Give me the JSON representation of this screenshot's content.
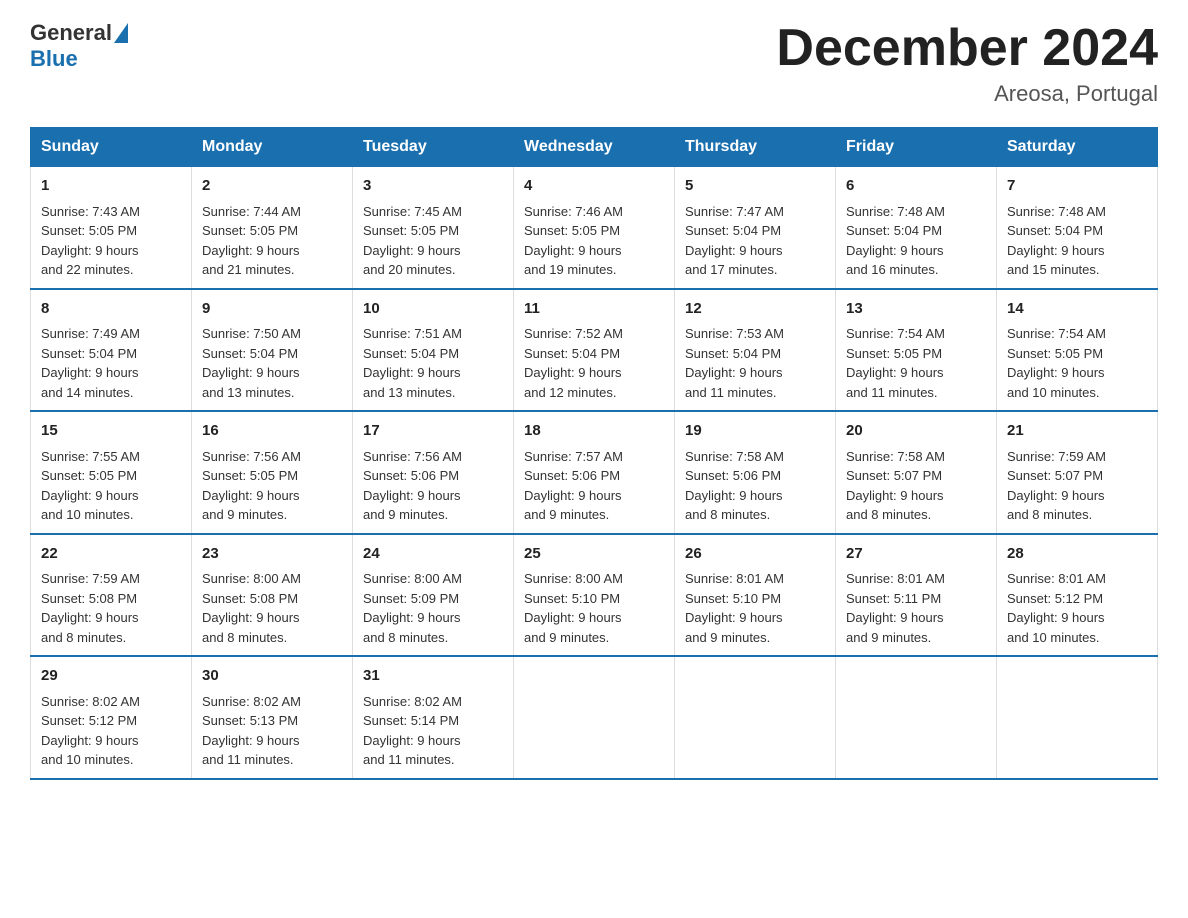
{
  "header": {
    "logo_general": "General",
    "logo_blue": "Blue",
    "month_year": "December 2024",
    "location": "Areosa, Portugal"
  },
  "days_of_week": [
    "Sunday",
    "Monday",
    "Tuesday",
    "Wednesday",
    "Thursday",
    "Friday",
    "Saturday"
  ],
  "weeks": [
    [
      {
        "day": "1",
        "sunrise": "7:43 AM",
        "sunset": "5:05 PM",
        "daylight": "9 hours and 22 minutes."
      },
      {
        "day": "2",
        "sunrise": "7:44 AM",
        "sunset": "5:05 PM",
        "daylight": "9 hours and 21 minutes."
      },
      {
        "day": "3",
        "sunrise": "7:45 AM",
        "sunset": "5:05 PM",
        "daylight": "9 hours and 20 minutes."
      },
      {
        "day": "4",
        "sunrise": "7:46 AM",
        "sunset": "5:05 PM",
        "daylight": "9 hours and 19 minutes."
      },
      {
        "day": "5",
        "sunrise": "7:47 AM",
        "sunset": "5:04 PM",
        "daylight": "9 hours and 17 minutes."
      },
      {
        "day": "6",
        "sunrise": "7:48 AM",
        "sunset": "5:04 PM",
        "daylight": "9 hours and 16 minutes."
      },
      {
        "day": "7",
        "sunrise": "7:48 AM",
        "sunset": "5:04 PM",
        "daylight": "9 hours and 15 minutes."
      }
    ],
    [
      {
        "day": "8",
        "sunrise": "7:49 AM",
        "sunset": "5:04 PM",
        "daylight": "9 hours and 14 minutes."
      },
      {
        "day": "9",
        "sunrise": "7:50 AM",
        "sunset": "5:04 PM",
        "daylight": "9 hours and 13 minutes."
      },
      {
        "day": "10",
        "sunrise": "7:51 AM",
        "sunset": "5:04 PM",
        "daylight": "9 hours and 13 minutes."
      },
      {
        "day": "11",
        "sunrise": "7:52 AM",
        "sunset": "5:04 PM",
        "daylight": "9 hours and 12 minutes."
      },
      {
        "day": "12",
        "sunrise": "7:53 AM",
        "sunset": "5:04 PM",
        "daylight": "9 hours and 11 minutes."
      },
      {
        "day": "13",
        "sunrise": "7:54 AM",
        "sunset": "5:05 PM",
        "daylight": "9 hours and 11 minutes."
      },
      {
        "day": "14",
        "sunrise": "7:54 AM",
        "sunset": "5:05 PM",
        "daylight": "9 hours and 10 minutes."
      }
    ],
    [
      {
        "day": "15",
        "sunrise": "7:55 AM",
        "sunset": "5:05 PM",
        "daylight": "9 hours and 10 minutes."
      },
      {
        "day": "16",
        "sunrise": "7:56 AM",
        "sunset": "5:05 PM",
        "daylight": "9 hours and 9 minutes."
      },
      {
        "day": "17",
        "sunrise": "7:56 AM",
        "sunset": "5:06 PM",
        "daylight": "9 hours and 9 minutes."
      },
      {
        "day": "18",
        "sunrise": "7:57 AM",
        "sunset": "5:06 PM",
        "daylight": "9 hours and 9 minutes."
      },
      {
        "day": "19",
        "sunrise": "7:58 AM",
        "sunset": "5:06 PM",
        "daylight": "9 hours and 8 minutes."
      },
      {
        "day": "20",
        "sunrise": "7:58 AM",
        "sunset": "5:07 PM",
        "daylight": "9 hours and 8 minutes."
      },
      {
        "day": "21",
        "sunrise": "7:59 AM",
        "sunset": "5:07 PM",
        "daylight": "9 hours and 8 minutes."
      }
    ],
    [
      {
        "day": "22",
        "sunrise": "7:59 AM",
        "sunset": "5:08 PM",
        "daylight": "9 hours and 8 minutes."
      },
      {
        "day": "23",
        "sunrise": "8:00 AM",
        "sunset": "5:08 PM",
        "daylight": "9 hours and 8 minutes."
      },
      {
        "day": "24",
        "sunrise": "8:00 AM",
        "sunset": "5:09 PM",
        "daylight": "9 hours and 8 minutes."
      },
      {
        "day": "25",
        "sunrise": "8:00 AM",
        "sunset": "5:10 PM",
        "daylight": "9 hours and 9 minutes."
      },
      {
        "day": "26",
        "sunrise": "8:01 AM",
        "sunset": "5:10 PM",
        "daylight": "9 hours and 9 minutes."
      },
      {
        "day": "27",
        "sunrise": "8:01 AM",
        "sunset": "5:11 PM",
        "daylight": "9 hours and 9 minutes."
      },
      {
        "day": "28",
        "sunrise": "8:01 AM",
        "sunset": "5:12 PM",
        "daylight": "9 hours and 10 minutes."
      }
    ],
    [
      {
        "day": "29",
        "sunrise": "8:02 AM",
        "sunset": "5:12 PM",
        "daylight": "9 hours and 10 minutes."
      },
      {
        "day": "30",
        "sunrise": "8:02 AM",
        "sunset": "5:13 PM",
        "daylight": "9 hours and 11 minutes."
      },
      {
        "day": "31",
        "sunrise": "8:02 AM",
        "sunset": "5:14 PM",
        "daylight": "9 hours and 11 minutes."
      },
      null,
      null,
      null,
      null
    ]
  ],
  "labels": {
    "sunrise": "Sunrise:",
    "sunset": "Sunset:",
    "daylight": "Daylight:"
  }
}
